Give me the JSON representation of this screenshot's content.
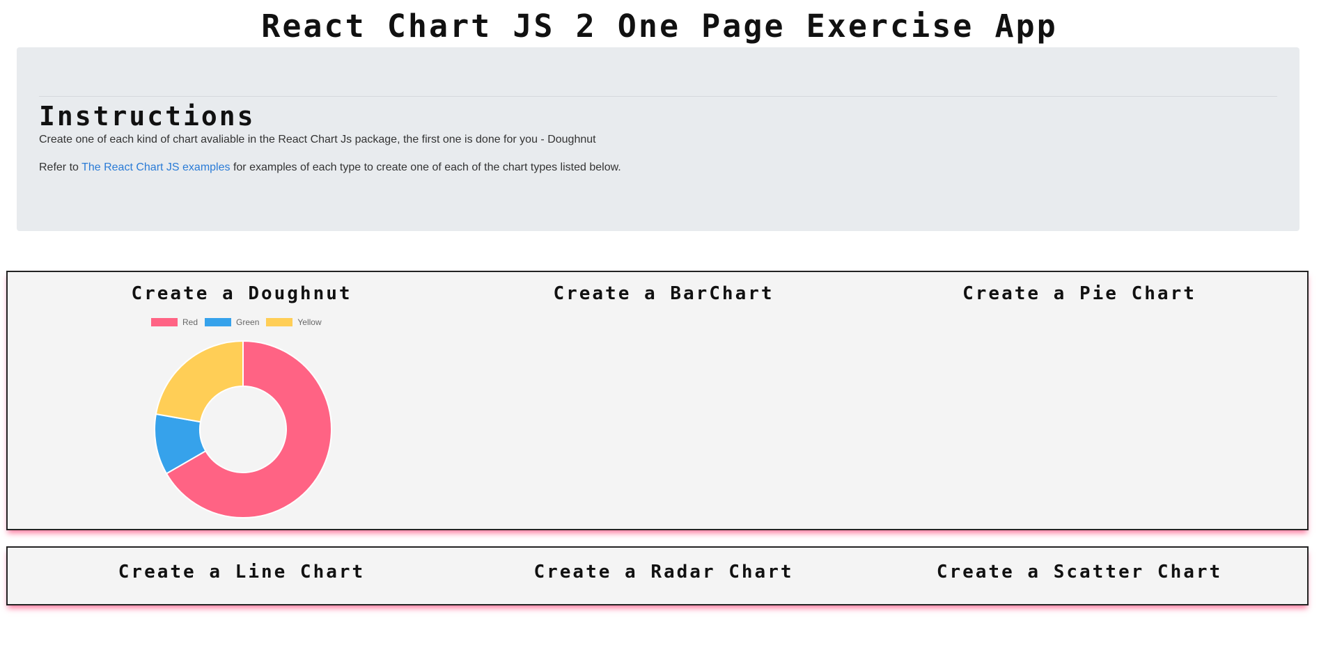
{
  "header": {
    "title": "React Chart JS 2 One Page Exercise App"
  },
  "instructions": {
    "heading": "Instructions",
    "line1": "Create one of each kind of chart avaliable in the React Chart Js package, the first one is done for you - Doughnut",
    "line2_prefix": "Refer to ",
    "line2_link": "The React Chart JS examples",
    "line2_suffix": " for examples of each type to create one of each of the chart types listed below."
  },
  "charts_row1": {
    "doughnut_title": "Create a Doughnut",
    "bar_title": "Create a BarChart",
    "pie_title": "Create a Pie Chart"
  },
  "charts_row2": {
    "line_title": "Create a Line Chart",
    "radar_title": "Create a Radar Chart",
    "scatter_title": "Create a Scatter Chart"
  },
  "colors": {
    "link": "#2a7bd6",
    "panel_shadow": "#ff5082"
  },
  "chart_data": {
    "type": "pie",
    "variant": "doughnut",
    "labels": [
      "Red",
      "Green",
      "Yellow"
    ],
    "values": [
      300,
      50,
      100
    ],
    "colors": [
      "#FF6384",
      "#36A2EB",
      "#FFCE56"
    ],
    "legend": "top"
  }
}
